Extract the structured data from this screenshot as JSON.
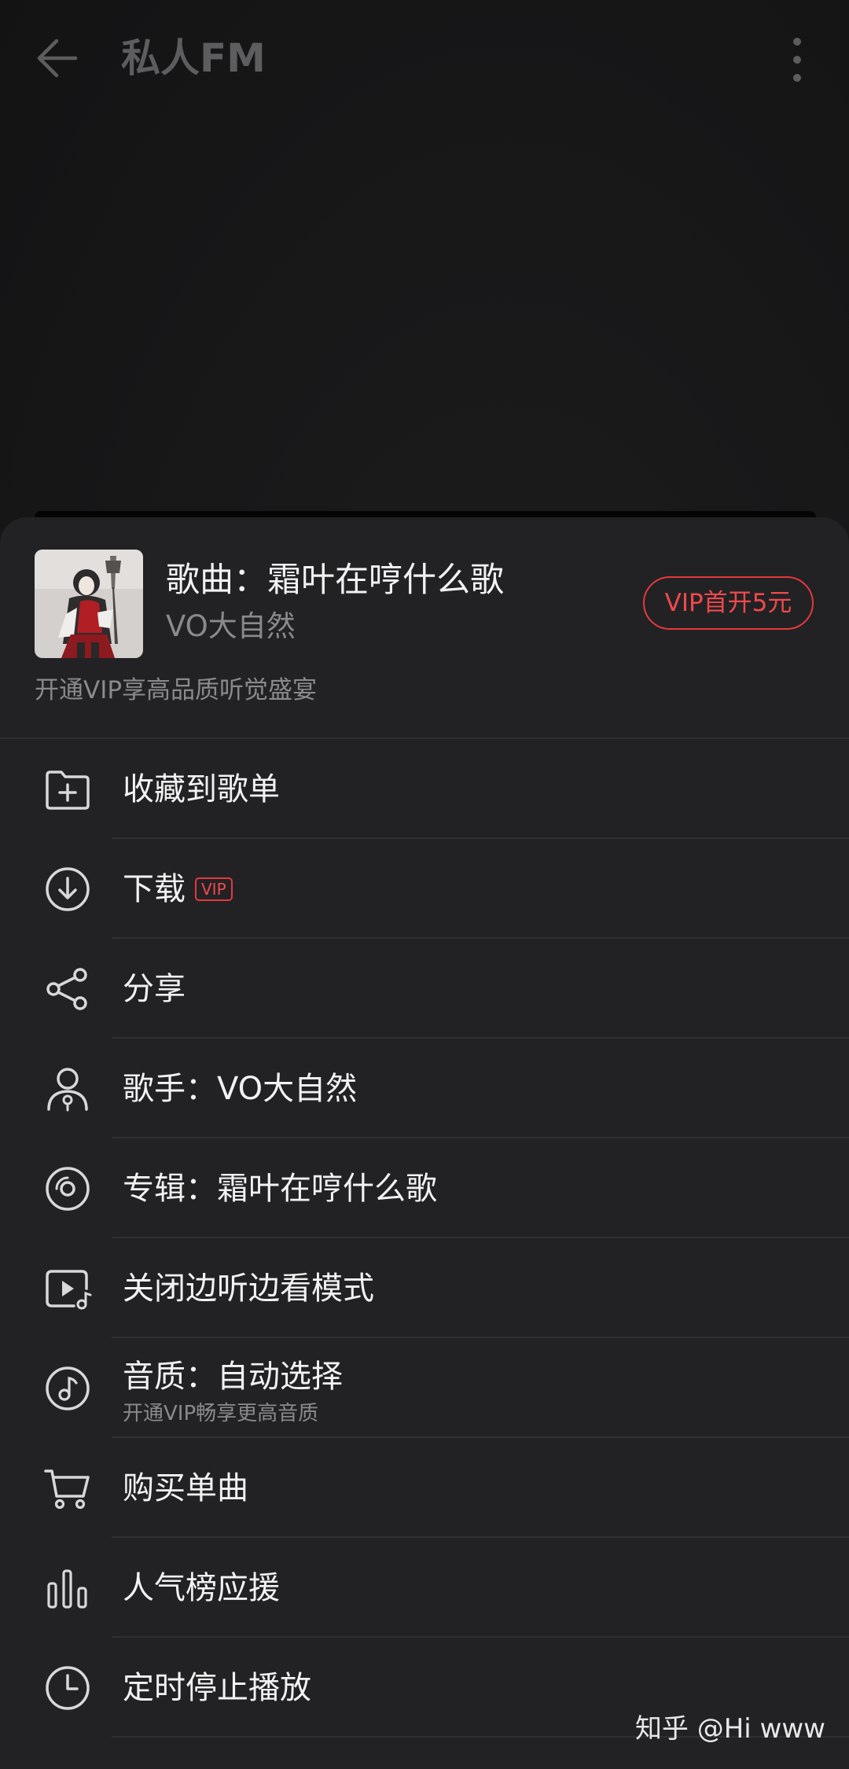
{
  "header": {
    "title": "私人FM"
  },
  "song": {
    "title": "歌曲：霜叶在哼什么歌",
    "artist": "VO大自然",
    "vip_button": "VIP首开5元",
    "vip_promo": "开通VIP享高品质听觉盛宴"
  },
  "menu": {
    "items": [
      {
        "label": "收藏到歌单",
        "icon": "add-to-playlist-icon"
      },
      {
        "label": "下载",
        "icon": "download-icon",
        "tag": "VIP"
      },
      {
        "label": "分享",
        "icon": "share-icon"
      },
      {
        "label": "歌手：VO大自然",
        "icon": "singer-icon"
      },
      {
        "label": "专辑：霜叶在哼什么歌",
        "icon": "album-icon"
      },
      {
        "label": "关闭边听边看模式",
        "icon": "video-music-icon"
      },
      {
        "label": "音质：自动选择",
        "icon": "sound-quality-icon",
        "sublabel": "开通VIP畅享更高音质"
      },
      {
        "label": "购买单曲",
        "icon": "cart-icon"
      },
      {
        "label": "人气榜应援",
        "icon": "chart-bars-icon"
      },
      {
        "label": "定时停止播放",
        "icon": "clock-icon"
      }
    ]
  },
  "watermark": "知乎 @Hi www",
  "colors": {
    "accent": "#e5383d",
    "sheet_bg": "#222224",
    "text_primary": "#f2f2f2",
    "text_secondary": "#8a8a8c"
  }
}
